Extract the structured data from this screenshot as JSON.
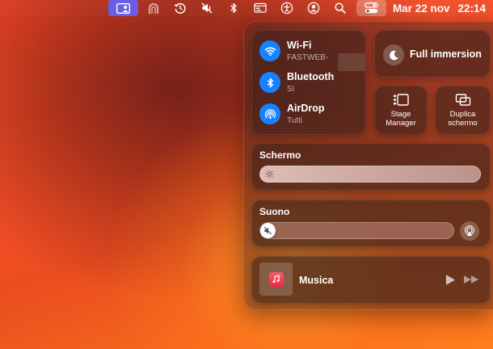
{
  "menubar": {
    "date": "Mar 22 nov",
    "time": "22:14"
  },
  "control_center": {
    "wifi": {
      "title": "Wi-Fi",
      "network": "FASTWEB-"
    },
    "bluetooth": {
      "title": "Bluetooth",
      "status": "Sì"
    },
    "airdrop": {
      "title": "AirDrop",
      "status": "Tutti"
    },
    "focus": {
      "label": "Full immersion"
    },
    "stage_manager": {
      "label": "Stage Manager"
    },
    "screen_mirroring": {
      "label": "Duplica schermo"
    },
    "display": {
      "title": "Schermo",
      "brightness": 1.0
    },
    "sound": {
      "title": "Suono",
      "volume": 0.0,
      "muted": true
    },
    "music": {
      "title": "Musica"
    }
  },
  "colors": {
    "accent_blue": "#1782ff",
    "menubar_highlight": "#6a5ee8",
    "music_red": "#f0263e"
  }
}
